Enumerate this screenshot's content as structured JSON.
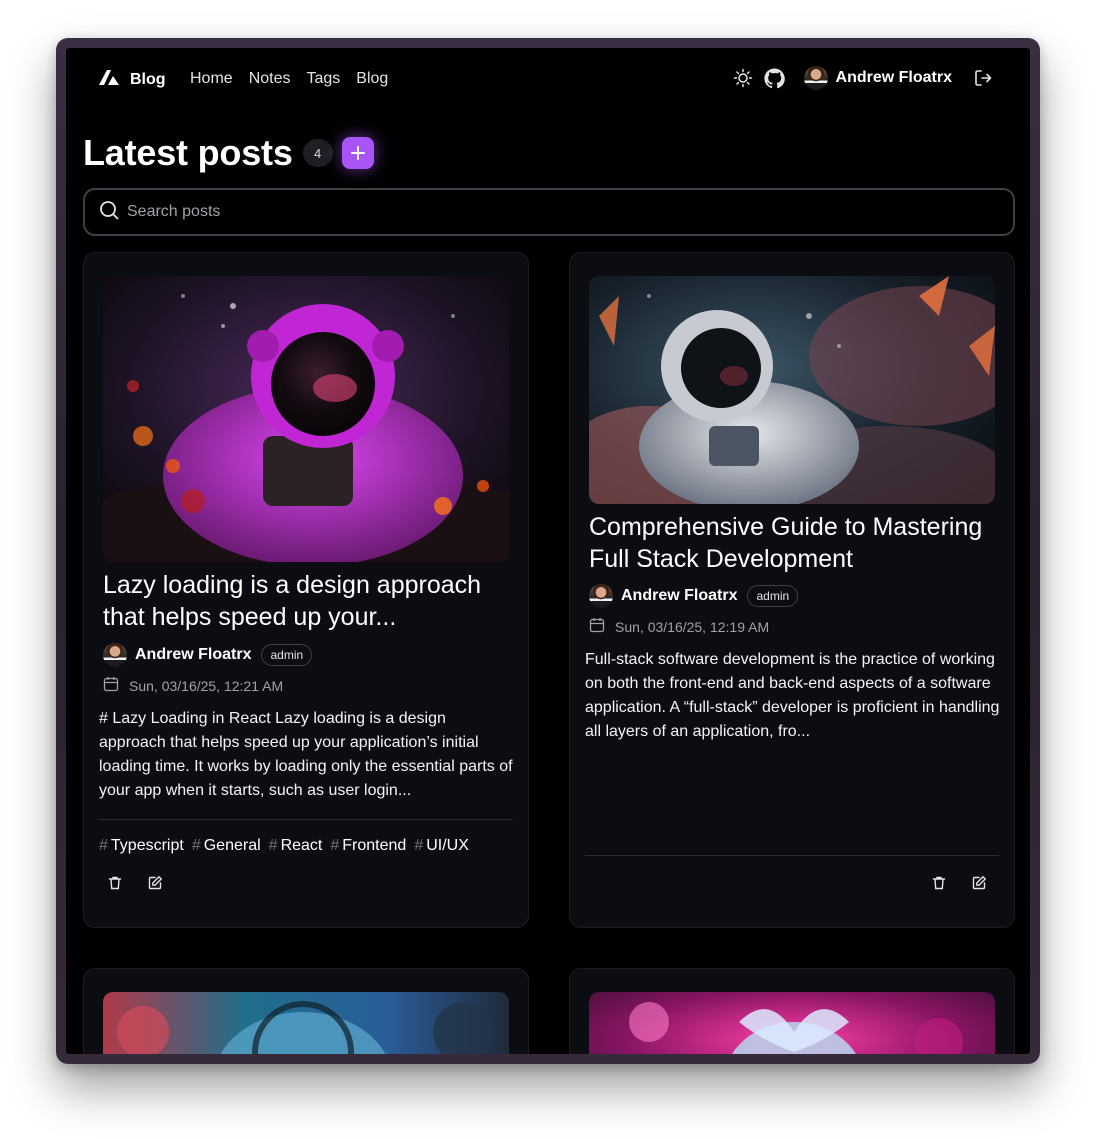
{
  "header": {
    "brand": "Blog",
    "nav": [
      "Home",
      "Notes",
      "Tags",
      "Blog"
    ],
    "user_name": "Andrew Floatrx"
  },
  "page": {
    "title": "Latest posts",
    "post_count": "4",
    "search_placeholder": "Search posts"
  },
  "posts": [
    {
      "title": "Lazy loading is a design approach that helps speed up your...",
      "author": "Andrew Floatrx",
      "role": "admin",
      "date": "Sun, 03/16/25, 12:21 AM",
      "excerpt": "# Lazy Loading in React Lazy loading is a design approach that helps speed up your application’s initial loading time. It works by loading only the essential parts of your app when it starts, such as user login...",
      "tags": [
        "Typescript",
        "General",
        "React",
        "Frontend",
        "UI/UX"
      ],
      "image_colors": [
        "#2a1030",
        "#a21caf",
        "#f97316"
      ]
    },
    {
      "title": "Comprehensive Guide to Mastering Full Stack Development",
      "author": "Andrew Floatrx",
      "role": "admin",
      "date": "Sun, 03/16/25, 12:19 AM",
      "excerpt": "Full-stack software development is the practice of working on both the front-end and back-end aspects of a software application. A “full-stack” developer is proficient in handling all layers of an application, fro...",
      "tags": [],
      "image_colors": [
        "#1e2a38",
        "#d1d5db",
        "#e07a5f"
      ]
    }
  ],
  "colors": {
    "accent": "#a855f7",
    "background": "#000000",
    "card": "#0b0d12"
  }
}
